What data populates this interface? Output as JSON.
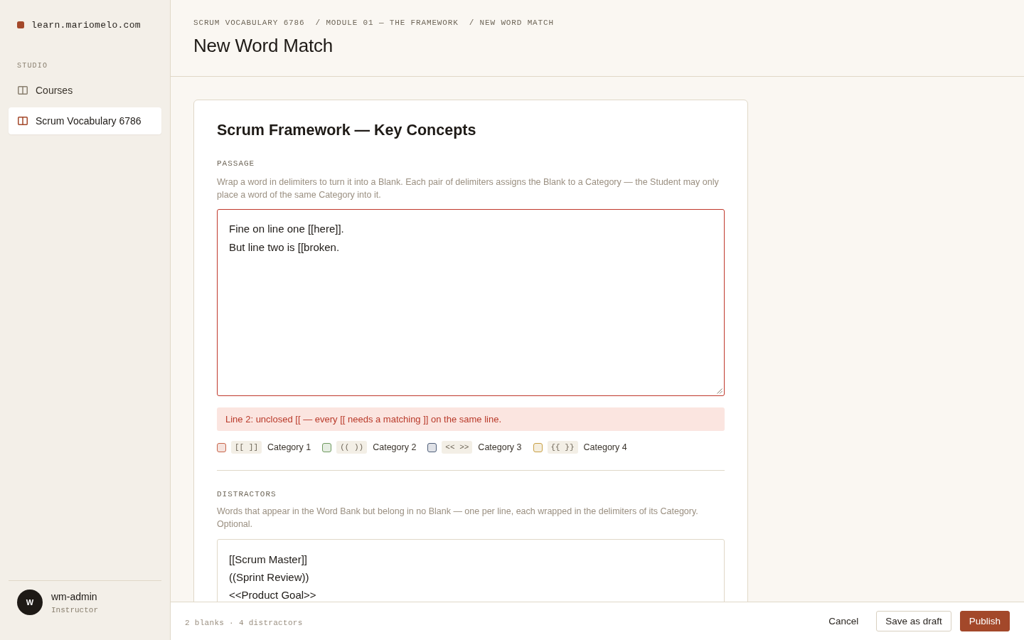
{
  "sidebar": {
    "site": "learn.mariomelo.com",
    "section_label": "STUDIO",
    "items": [
      {
        "label": "Courses",
        "selected": false
      },
      {
        "label": "Scrum Vocabulary 6786",
        "selected": true
      }
    ],
    "user": {
      "initial": "W",
      "name": "wm-admin",
      "role": "Instructor"
    }
  },
  "header": {
    "breadcrumb": [
      "SCRUM VOCABULARY 6786",
      "/ MODULE 01 — THE FRAMEWORK",
      "/ NEW WORD MATCH"
    ],
    "title": "New Word Match"
  },
  "card": {
    "title": "Scrum Framework — Key Concepts",
    "passage": {
      "label": "PASSAGE",
      "help": "Wrap a word in delimiters to turn it into a Blank. Each pair of delimiters assigns the Blank to a Category — the Student may only place a word of the same Category into it.",
      "lines": [
        "Fine on line one [[here]].",
        "But line two is [[broken."
      ],
      "invalid": true,
      "error": "Line 2: unclosed [[ — every [[ needs a matching ]] on the same line."
    },
    "categories": [
      {
        "delimiters": "[[ ]]",
        "label": "Category 1",
        "color": "#c8654a"
      },
      {
        "delimiters": "(( ))",
        "label": "Category 2",
        "color": "#6f9a5f"
      },
      {
        "delimiters": "<< >>",
        "label": "Category 3",
        "color": "#50607a"
      },
      {
        "delimiters": "{{ }}",
        "label": "Category 4",
        "color": "#c9a045"
      }
    ],
    "distractors": {
      "label": "DISTRACTORS",
      "help": "Words that appear in the Word Bank but belong in no Blank — one per line, each wrapped in the delimiters of its Category. Optional.",
      "lines": [
        "[[Scrum Master]]",
        "((Sprint Review))",
        "<<Product Goal>>"
      ],
      "invalid": false
    }
  },
  "footer": {
    "status": "2 blanks · 4 distractors",
    "buttons": [
      {
        "label": "Cancel",
        "kind": "text"
      },
      {
        "label": "Save as draft",
        "kind": "secondary"
      },
      {
        "label": "Publish",
        "kind": "primary"
      }
    ]
  }
}
